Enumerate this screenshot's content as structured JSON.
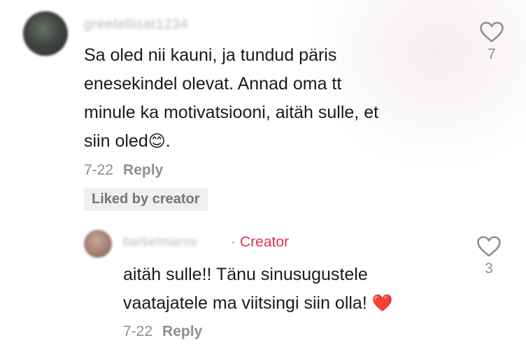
{
  "comment": {
    "username": "greetellisat1234",
    "lines": [
      "Sa oled nii kauni, ja tundud päris",
      "enesekindel olevat. Annad oma tt",
      "minule ka motivatsiooni, aitäh sulle, et"
    ],
    "last_line_text": "siin oled",
    "last_line_emoji": "😊",
    "last_line_end": ".",
    "date": "7-22",
    "reply_label": "Reply",
    "liked_by_label": "Liked by creator",
    "like_count": "7",
    "like_icon": "heart-outline-icon"
  },
  "reply": {
    "username": "barbelmaros",
    "separator": "·",
    "creator_label": "Creator",
    "line1": "aitäh sulle!! Tänu sinusugustele",
    "line2_text": "vaatajatele ma viitsingi siin olla!",
    "line2_emoji": "❤️",
    "date": "7-22",
    "reply_label": "Reply",
    "like_count": "3",
    "like_icon": "heart-outline-icon"
  },
  "colors": {
    "creator_accent": "#e0334f",
    "meta_gray": "#8e8e8e",
    "text": "#1a1a1a",
    "badge_bg": "#efefef"
  }
}
